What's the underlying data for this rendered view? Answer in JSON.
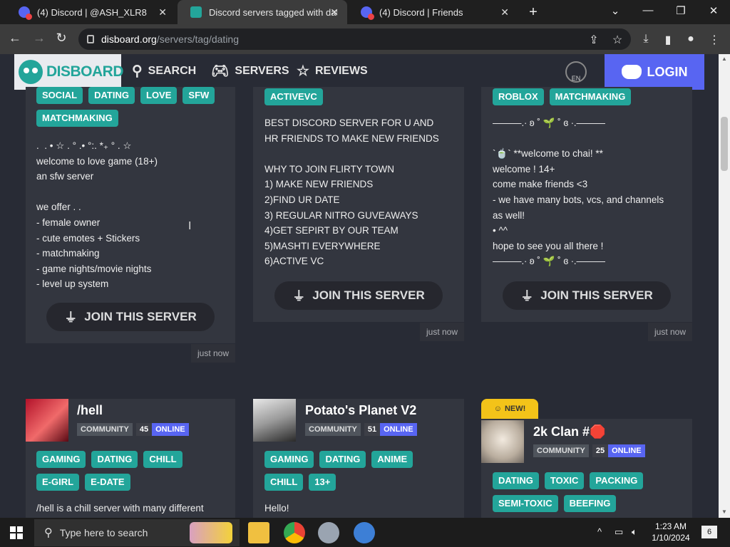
{
  "browser": {
    "tabs": [
      {
        "title": "(4) Discord | @ASH_XLR8",
        "active": false
      },
      {
        "title": "Discord servers tagged with dati",
        "active": true
      },
      {
        "title": "(4) Discord | Friends",
        "active": false
      }
    ],
    "new_tab": "+",
    "url_host": "disboard.org",
    "url_path": "/servers/tag/dating"
  },
  "site": {
    "brand": "DISBOARD",
    "nav": {
      "search": "SEARCH",
      "servers": "SERVERS",
      "reviews": "REVIEWS"
    },
    "lang": "EN",
    "login": "LOGIN"
  },
  "cards_top": [
    {
      "tags": [
        "SOCIAL",
        "DATING",
        "LOVE",
        "SFW",
        "MATCHMAKING"
      ],
      "description": ".  . • ☆ . ° .• °:. *₊ ° . ☆\nwelcome to love game (18+)\nan sfw server\n\nwe offer . .\n- female owner\n- cute emotes + Stickers\n- matchmaking\n- game nights/movie nights\n- level up system",
      "join_label": "JOIN THIS SERVER",
      "timestamp": "just now"
    },
    {
      "tags": [
        "ACTIVEVC"
      ],
      "description": "BEST DISCORD SERVER FOR U AND\nHR FRIENDS TO MAKE NEW FRIENDS\n\nWHY TO JOIN FLIRTY TOWN\n1) MAKE NEW FRIENDS\n2)FIND UR DATE\n3) REGULAR NITRO GUVEAWAYS\n4)GET SEPIRT BY OUR TEAM\n5)MASHTI EVERYWHERE\n6)ACTIVE VC",
      "join_label": "JOIN THIS SERVER",
      "timestamp": "just now"
    },
    {
      "tags": [
        "ROBLOX",
        "MATCHMAKING"
      ],
      "description": "———.∙ ʚ ˚ 🌱 ˚ ɞ ∙.———\n\n`🍵` **welcome to chai! **\nwelcome ! 14+\ncome make friends <3\n- we have many bots, vcs, and channels\nas well!\n• ^^\nhope to see you all there !\n———.∙ ʚ ˚ 🌱 ˚ ɞ ∙.———",
      "join_label": "JOIN THIS SERVER",
      "timestamp": "just now"
    }
  ],
  "cards_bottom": [
    {
      "name": "/hell",
      "category": "COMMUNITY",
      "online_count": "45",
      "online_label": "ONLINE",
      "tags": [
        "GAMING",
        "DATING",
        "CHILL",
        "E-GIRL",
        "E-DATE"
      ],
      "description": "/hell is a chill server with many different"
    },
    {
      "name": "Potato's Planet V2",
      "category": "COMMUNITY",
      "online_count": "51",
      "online_label": "ONLINE",
      "tags": [
        "GAMING",
        "DATING",
        "ANIME",
        "CHILL",
        "13+"
      ],
      "description": "Hello!"
    },
    {
      "badge": "NEW!",
      "name": "2k Clan #🛑",
      "category": "COMMUNITY",
      "online_count": "25",
      "online_label": "ONLINE",
      "tags": [
        "DATING",
        "TOXIC",
        "PACKING",
        "SEMI-TOXIC",
        "BEEFING"
      ]
    }
  ],
  "taskbar": {
    "search_placeholder": "Type here to search",
    "time": "1:23 AM",
    "date": "1/10/2024",
    "notifications": "6"
  },
  "colors": {
    "accent": "#23a59a",
    "brand": "#5865f2",
    "new_badge": "#f3c319",
    "page_bg": "#282b35",
    "card_bg": "#33363f"
  }
}
